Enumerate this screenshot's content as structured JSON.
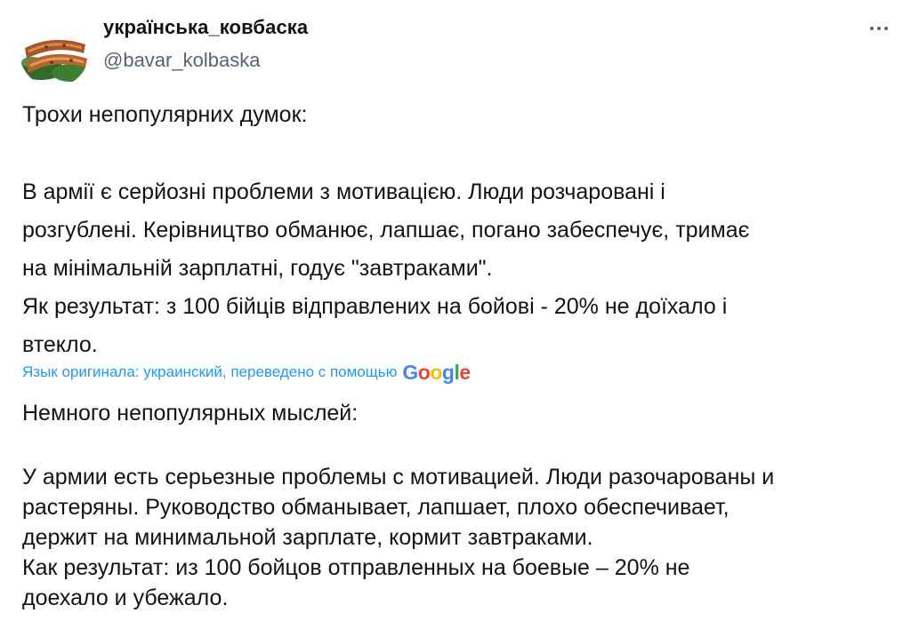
{
  "author": {
    "display_name": "українська_ковбаска",
    "handle": "@bavar_kolbaska",
    "avatar_icon": "sausages-avatar-icon"
  },
  "actions": {
    "more_icon": "more-dots-icon"
  },
  "tweet": {
    "first_line": "Трохи непопулярних думок:",
    "body_lines": [
      "В армії є серйозні проблеми з мотивацією. Люди розчаровані і",
      "розгублені. Керівництво обманює, лапшає, погано забеспечує, тримає",
      "на мінімальній зарплатні, годує \"завтраками\".",
      "Як результат: з 100 бійців відправлених на бойові - 20% не доїхало і",
      "втекло."
    ]
  },
  "translation": {
    "label": "Язык оригинала: украинский, переведено с помощью",
    "provider_letters": [
      "G",
      "o",
      "o",
      "g",
      "l",
      "e"
    ],
    "first_line": "Немного непопулярных мыслей:",
    "body_lines": [
      "У армии есть серьезные проблемы с мотивацией. Люди разочарованы и",
      "растеряны. Руководство обманывает, лапшает, плохо обеспечивает,",
      "держит на минимальной зарплате, кормит завтраками.",
      "Как результат: из 100 бойцов отправленных на боевые – 20% не",
      "доехало и убежало."
    ]
  },
  "colors": {
    "text": "#0f1419",
    "secondary_text": "#536471",
    "link": "#1d9bf0",
    "google_blue": "#4285f4",
    "google_red": "#ea4335",
    "google_yellow": "#fbbc05",
    "google_green": "#34a853"
  }
}
